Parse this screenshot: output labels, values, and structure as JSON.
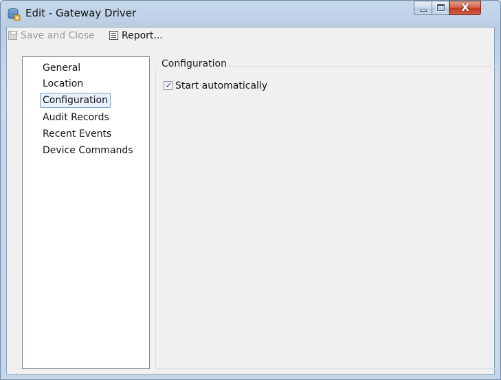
{
  "window": {
    "title": "Edit - Gateway Driver",
    "app_icon": "database-icon",
    "controls": {
      "minimize": "minimize-icon",
      "maximize": "maximize-icon",
      "close_glyph": "X"
    }
  },
  "toolbar": {
    "save_label": "Save and Close",
    "save_icon": "save-icon",
    "save_enabled": false,
    "report_label": "Report...",
    "report_icon": "report-icon"
  },
  "nav": {
    "items": [
      {
        "label": "General",
        "selected": false
      },
      {
        "label": "Location",
        "selected": false
      },
      {
        "label": "Configuration",
        "selected": true
      },
      {
        "label": "Audit Records",
        "selected": false
      },
      {
        "label": "Recent Events",
        "selected": false
      },
      {
        "label": "Device Commands",
        "selected": false
      }
    ]
  },
  "configuration": {
    "group_title": "Configuration",
    "start_automatically": {
      "label": "Start automatically",
      "checked": true
    }
  },
  "colors": {
    "frame": "#c5d6e8",
    "client": "#f0f0f0",
    "selection_border": "#7da2ce",
    "selection_fill": "#e9f2fc",
    "close_button": "#c2391d"
  }
}
